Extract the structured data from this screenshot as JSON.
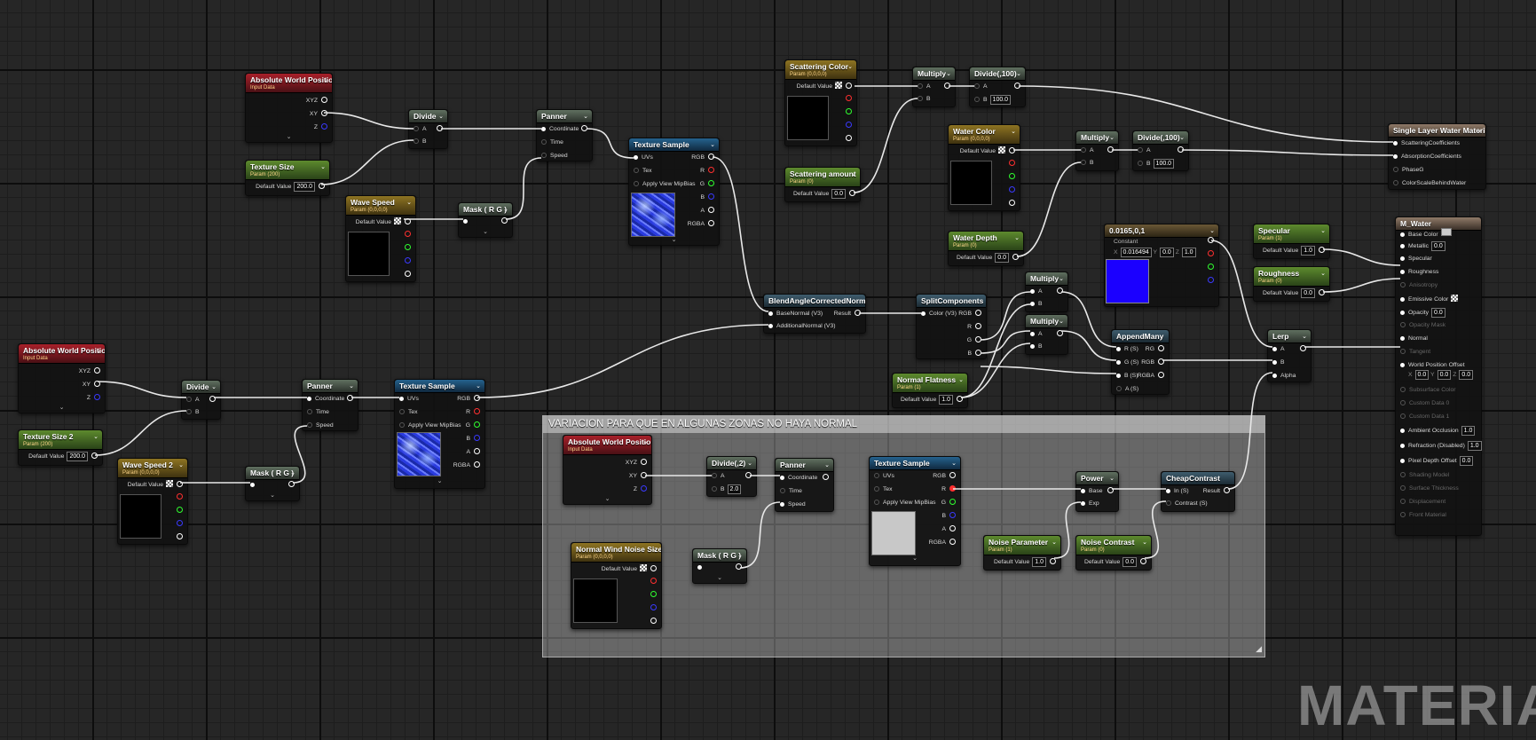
{
  "colors": {
    "wire": "#e8e8e8",
    "bg": "#262626",
    "comment": "#8a8a8a",
    "constant_blue": "#1b00ff"
  },
  "icons": {
    "pin_in": "filled-circle",
    "pin_out": "hollow-circle",
    "collapse": "chevron-down-icon",
    "dropdown": "chevron-down-icon",
    "resize": "resize-grip-icon"
  },
  "comment": {
    "title": "VARIACION PARA QUE EN ALGUNAS ZONAS NO HAYA NORMAL"
  },
  "watermark": "MATERIAL",
  "labels": {
    "xyz": "XYZ",
    "xy": "XY",
    "z": "Z",
    "a": "A",
    "b": "B",
    "coordinate": "Coordinate",
    "time": "Time",
    "speed": "Speed",
    "uvs": "UVs",
    "tex": "Tex",
    "apply_view_mipbias": "Apply View MipBias",
    "rgb": "RGB",
    "r": "R",
    "g": "G",
    "bb": "B",
    "alpha_a": "A",
    "rgba": "RGBA",
    "default_value": "Default Value",
    "result": "Result",
    "alpha": "Alpha",
    "base": "Base",
    "exp": "Exp",
    "in_s": "In (S)",
    "contrast_s": "Contrast (S)",
    "color_v3": "Color (V3)",
    "basenormal": "BaseNormal (V3)",
    "additionalnormal": "AdditionalNormal (V3)",
    "r_s": "R (S)",
    "g_s": "G (S)",
    "b_s": "B (S)",
    "a_s": "A (S)",
    "rg": "RG",
    "constant": "Constant",
    "x": "X",
    "y": "Y"
  },
  "nodes": {
    "awp1": {
      "title": "Absolute World Position",
      "sub": "Input Data"
    },
    "ts1": {
      "title": "Texture Size",
      "sub": "Param (200)",
      "value": "200.0"
    },
    "div1": {
      "title": "Divide"
    },
    "ws1": {
      "title": "Wave Speed",
      "sub": "Param (0,0,0,0)"
    },
    "mask1": {
      "title": "Mask ( R G )"
    },
    "pan1": {
      "title": "Panner"
    },
    "tsamp1": {
      "title": "Texture Sample"
    },
    "sc": {
      "title": "Scattering Color",
      "sub": "Param (0,0,0,0)"
    },
    "sa": {
      "title": "Scattering amount",
      "sub": "Param (0)",
      "value": "0.0"
    },
    "mul1": {
      "title": "Multiply"
    },
    "div100a": {
      "title": "Divide(,100)",
      "b": "100.0"
    },
    "wc": {
      "title": "Water Color",
      "sub": "Param (0,0,0,0)"
    },
    "wd": {
      "title": "Water Depth",
      "sub": "Param (0)",
      "value": "0.0"
    },
    "mul2": {
      "title": "Multiply"
    },
    "div100b": {
      "title": "Divide(,100)",
      "b": "100.0"
    },
    "slwm": {
      "title": "Single Layer Water Material",
      "pins": [
        "ScatteringCoefficients",
        "AbsorptionCoefficients",
        "PhaseG",
        "ColorScaleBehindWater"
      ]
    },
    "const3": {
      "title": "0.0165,0,1",
      "x": "0.016494",
      "y": "0.0",
      "z": "1.0"
    },
    "spec": {
      "title": "Specular",
      "sub": "Param (1)",
      "value": "1.0"
    },
    "rough": {
      "title": "Roughness",
      "sub": "Param (0)",
      "value": "0.0"
    },
    "mwater": {
      "title": "M_Water",
      "base_color": "Base Color",
      "metallic": "Metallic",
      "metallic_v": "0.0",
      "specular": "Specular",
      "roughness": "Roughness",
      "anisotropy": "Anisotropy",
      "emissive": "Emissive Color",
      "opacity": "Opacity",
      "opacity_v": "0.0",
      "opacity_mask": "Opacity Mask",
      "normal": "Normal",
      "tangent": "Tangent",
      "wpo": "World Position Offset",
      "wpo_x": "0.0",
      "wpo_y": "0.0",
      "wpo_z": "0.0",
      "subsurface": "Subsurface Color",
      "custom0": "Custom Data 0",
      "custom1": "Custom Data 1",
      "ao": "Ambient Occlusion",
      "ao_v": "1.0",
      "refraction": "Refraction (Disabled)",
      "refraction_v": "1.0",
      "pdo": "Pixel Depth Offset",
      "pdo_v": "0.0",
      "shading": "Shading Model",
      "thickness": "Surface Thickness",
      "displacement": "Displacement",
      "front_material": "Front Material"
    },
    "bacn": {
      "title": "BlendAngleCorrectedNormals"
    },
    "split": {
      "title": "SplitComponents"
    },
    "mul3": {
      "title": "Multiply"
    },
    "mul4": {
      "title": "Multiply"
    },
    "nf": {
      "title": "Normal Flatness",
      "sub": "Param (1)",
      "value": "1.0"
    },
    "append": {
      "title": "AppendMany"
    },
    "lerp": {
      "title": "Lerp"
    },
    "awp2": {
      "title": "Absolute World Position",
      "sub": "Input Data"
    },
    "ts2": {
      "title": "Texture Size 2",
      "sub": "Param (200)",
      "value": "200.0"
    },
    "div2": {
      "title": "Divide"
    },
    "ws2": {
      "title": "Wave Speed 2",
      "sub": "Param (0,0,0,0)"
    },
    "mask2": {
      "title": "Mask ( R G )"
    },
    "pan2": {
      "title": "Panner"
    },
    "tsamp2": {
      "title": "Texture Sample"
    },
    "awp3": {
      "title": "Absolute World Position",
      "sub": "Input Data"
    },
    "div3": {
      "title": "Divide(,2)",
      "b": "2.0"
    },
    "pan3": {
      "title": "Panner"
    },
    "tsamp3": {
      "title": "Texture Sample"
    },
    "nwns": {
      "title": "Normal Wind Noise Size",
      "sub": "Param (0,0,0,0)"
    },
    "mask3": {
      "title": "Mask ( R G )"
    },
    "power": {
      "title": "Power"
    },
    "np": {
      "title": "Noise Parameter",
      "sub": "Param (1)",
      "value": "1.0"
    },
    "nc": {
      "title": "Noise Contrast",
      "sub": "Param (0)",
      "value": "0.0"
    },
    "cc": {
      "title": "CheapContrast"
    }
  }
}
